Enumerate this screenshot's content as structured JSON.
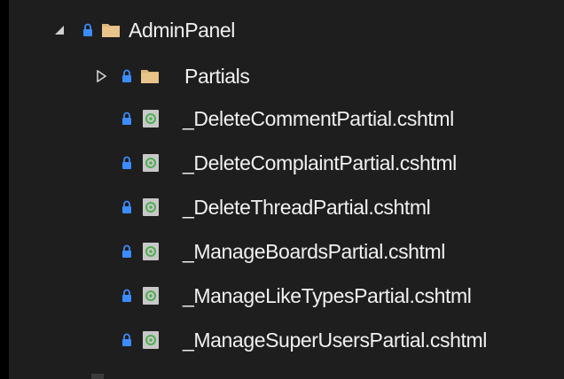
{
  "colors": {
    "background": "#1e1e1e",
    "text": "#f1f1f1",
    "lock": "#3c8cff",
    "folder": "#dcb67a",
    "razor_file": "#c8c8c8",
    "razor_at": "#4fae51",
    "expander": "#d0d0d0"
  },
  "tree": {
    "root": {
      "label": "AdminPanel",
      "icon": "folder-icon",
      "expanded": true,
      "locked": true
    },
    "children": [
      {
        "label": "Partials",
        "icon": "folder-icon",
        "expanded": false,
        "locked": true
      },
      {
        "label": "_DeleteCommentPartial.cshtml",
        "icon": "razor-file-icon",
        "locked": true
      },
      {
        "label": "_DeleteComplaintPartial.cshtml",
        "icon": "razor-file-icon",
        "locked": true
      },
      {
        "label": "_DeleteThreadPartial.cshtml",
        "icon": "razor-file-icon",
        "locked": true
      },
      {
        "label": "_ManageBoardsPartial.cshtml",
        "icon": "razor-file-icon",
        "locked": true
      },
      {
        "label": "_ManageLikeTypesPartial.cshtml",
        "icon": "razor-file-icon",
        "locked": true
      },
      {
        "label": "_ManageSuperUsersPartial.cshtml",
        "icon": "razor-file-icon",
        "locked": true
      }
    ]
  }
}
